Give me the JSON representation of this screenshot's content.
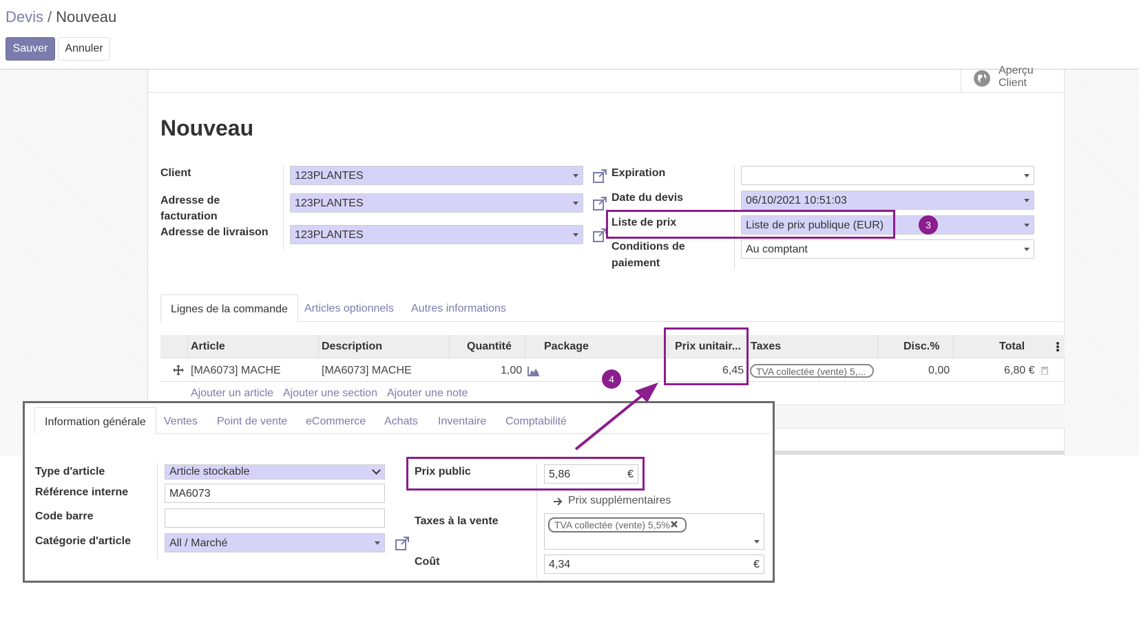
{
  "breadcrumb": {
    "parent": "Devis",
    "current": "Nouveau"
  },
  "buttons": {
    "save": "Sauver",
    "cancel": "Annuler"
  },
  "smart_button": {
    "line1": "Aperçu",
    "line2": "Client"
  },
  "form": {
    "title": "Nouveau",
    "left": {
      "client_label": "Client",
      "client_value": "123PLANTES",
      "billing_label_1": "Adresse de",
      "billing_label_2": "facturation",
      "billing_value": "123PLANTES",
      "shipping_label": "Adresse de livraison",
      "shipping_value": "123PLANTES"
    },
    "right": {
      "expiration_label": "Expiration",
      "expiration_value": "",
      "date_label": "Date du devis",
      "date_value": "06/10/2021 10:51:03",
      "pricelist_label": "Liste de prix",
      "pricelist_value": "Liste de prix publique (EUR)",
      "terms_label_1": "Conditions de",
      "terms_label_2": "paiement",
      "terms_value": "Au comptant"
    }
  },
  "tabs": [
    "Lignes de la commande",
    "Articles optionnels",
    "Autres informations"
  ],
  "table": {
    "headers": [
      "Article",
      "Description",
      "Quantité",
      "Package",
      "Prix unitair...",
      "Taxes",
      "Disc.%",
      "Total"
    ],
    "row": {
      "article": "[MA6073] MACHE",
      "description": "[MA6073] MACHE",
      "quantity": "1,00",
      "unit_price": "6,45",
      "taxes": "TVA collectée (vente) 5,...",
      "discount": "0,00",
      "total": "6,80 €"
    },
    "add_links": [
      "Ajouter un article",
      "Ajouter une section",
      "Ajouter une note"
    ]
  },
  "annotations": {
    "badge3": "3",
    "badge4": "4",
    "highlight_color": "#8b1d8c"
  },
  "product_inset": {
    "tabs": [
      "Information générale",
      "Ventes",
      "Point de vente",
      "eCommerce",
      "Achats",
      "Inventaire",
      "Comptabilité"
    ],
    "type_label": "Type d'article",
    "type_value": "Article stockable",
    "ref_label": "Référence interne",
    "ref_value": "MA6073",
    "barcode_label": "Code barre",
    "barcode_value": "",
    "category_label": "Catégorie d'article",
    "category_value": "All / Marché",
    "public_price_label": "Prix public",
    "public_price_value": "5,86",
    "currency": "€",
    "extra_prices": "Prix supplémentaires",
    "sale_taxes_label": "Taxes à la vente",
    "sale_tax_tag": "TVA collectée (vente) 5,5%",
    "cost_label": "Coût",
    "cost_value": "4,34"
  },
  "colors": {
    "accent": "#7c7bad",
    "selection_field": "#d5d4f8"
  }
}
